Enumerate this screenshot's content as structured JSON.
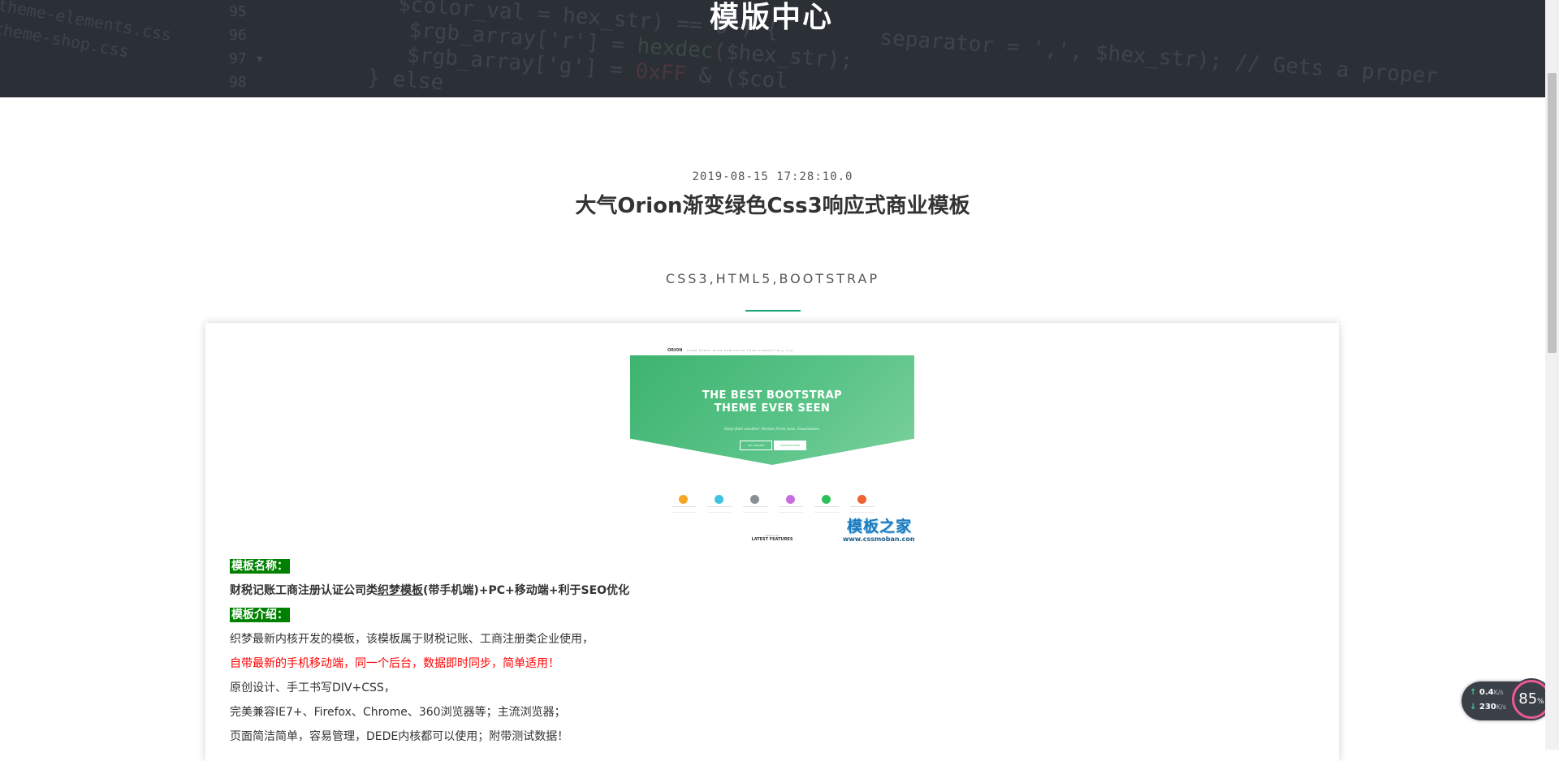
{
  "header": {
    "title": "模版中心"
  },
  "article": {
    "date": "2019-08-15 17:28:10.0",
    "title": "大气Orion渐变绿色Css3响应式商业模板",
    "tags": "CSS3,HTML5,BOOTSTRAP"
  },
  "preview": {
    "nav_logo": "ORION",
    "nav_links": "HOME  PAGES  BLOG  PORTFOLIO  SHOP  CONTACT  Buy now",
    "hero_line1": "THE BEST BOOTSTRAP",
    "hero_line2": "THEME EVER SEEN",
    "hero_sub": "Stop find another theme from now, Guarantee.",
    "btn1": "GET STARTED",
    "btn2": "PURCHASE NOW",
    "latest_small": "What's new",
    "latest": "LATEST FEATURES",
    "watermark": "模板之家",
    "watermark_url": "www.cssmoban.com",
    "hero_color": "#3eb36f"
  },
  "content": {
    "label_name": "模板名称：",
    "name_prefix": "财税记账工商注册认证公司类",
    "name_link": "织梦模板",
    "name_suffix": "(带手机端)+PC+移动端+利于SEO优化",
    "label_intro": "模板介绍：",
    "line1": "织梦最新内核开发的模板，该模板属于财税记账、工商注册类企业使用，",
    "line2_red": "自带最新的手机移动端，同一个后台，数据即时同步，简单适用！",
    "line3": "原创设计、手工书写DIV+CSS，",
    "line4": "完美兼容IE7+、Firefox、Chrome、360浏览器等；主流浏览器；",
    "line5": "页面简洁简单，容易管理，DEDE内核都可以使用；附带测试数据！"
  },
  "speed_widget": {
    "up": "0.4",
    "up_unit": "K/s",
    "down": "230",
    "down_unit": "K/s",
    "percent": "85",
    "percent_sign": "%"
  }
}
